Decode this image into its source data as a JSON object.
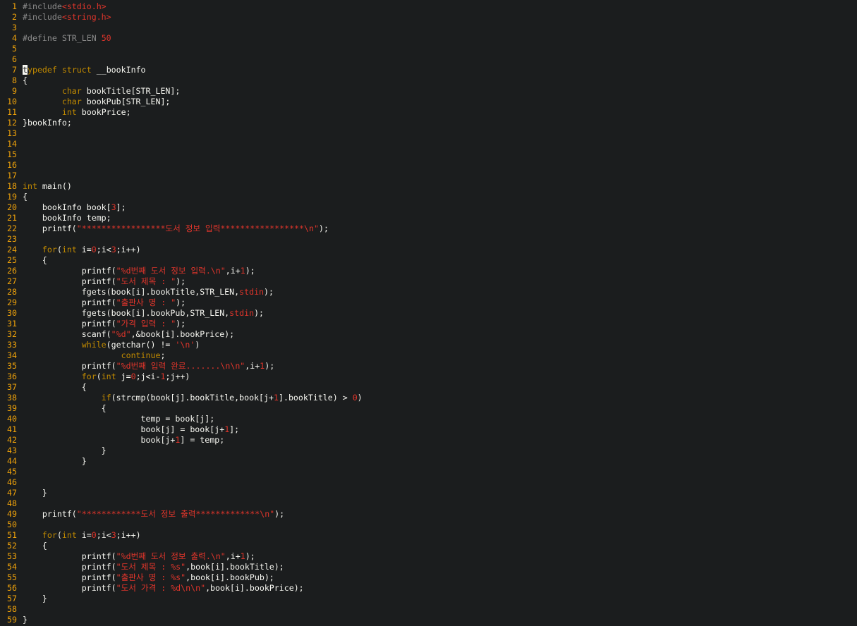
{
  "editor": {
    "lines": [
      {
        "n": "1",
        "tokens": [
          {
            "t": "#include",
            "c": "pp"
          },
          {
            "t": "<stdio.h>",
            "c": "str"
          }
        ]
      },
      {
        "n": "2",
        "tokens": [
          {
            "t": "#include",
            "c": "pp"
          },
          {
            "t": "<string.h>",
            "c": "str"
          }
        ]
      },
      {
        "n": "3",
        "tokens": []
      },
      {
        "n": "4",
        "tokens": [
          {
            "t": "#define STR_LEN ",
            "c": "pp"
          },
          {
            "t": "50",
            "c": "num"
          }
        ]
      },
      {
        "n": "5",
        "tokens": []
      },
      {
        "n": "6",
        "tokens": []
      },
      {
        "n": "7",
        "tokens": [
          {
            "t": "t",
            "c": "cursor"
          },
          {
            "t": "ypedef",
            "c": "kw"
          },
          {
            "t": " ",
            "c": "id"
          },
          {
            "t": "struct",
            "c": "kw"
          },
          {
            "t": " __bookInfo",
            "c": "id"
          }
        ]
      },
      {
        "n": "8",
        "tokens": [
          {
            "t": "{",
            "c": "id"
          }
        ]
      },
      {
        "n": "9",
        "tokens": [
          {
            "t": "        ",
            "c": "id"
          },
          {
            "t": "char",
            "c": "ty"
          },
          {
            "t": " bookTitle[STR_LEN];",
            "c": "id"
          }
        ]
      },
      {
        "n": "10",
        "tokens": [
          {
            "t": "        ",
            "c": "id"
          },
          {
            "t": "char",
            "c": "ty"
          },
          {
            "t": " bookPub[STR_LEN];",
            "c": "id"
          }
        ]
      },
      {
        "n": "11",
        "tokens": [
          {
            "t": "        ",
            "c": "id"
          },
          {
            "t": "int",
            "c": "ty"
          },
          {
            "t": " bookPrice;",
            "c": "id"
          }
        ]
      },
      {
        "n": "12",
        "tokens": [
          {
            "t": "}bookInfo;",
            "c": "id"
          }
        ]
      },
      {
        "n": "13",
        "tokens": []
      },
      {
        "n": "14",
        "tokens": []
      },
      {
        "n": "15",
        "tokens": []
      },
      {
        "n": "16",
        "tokens": []
      },
      {
        "n": "17",
        "tokens": []
      },
      {
        "n": "18",
        "tokens": [
          {
            "t": "int",
            "c": "ty"
          },
          {
            "t": " main()",
            "c": "id"
          }
        ]
      },
      {
        "n": "19",
        "tokens": [
          {
            "t": "{",
            "c": "id"
          }
        ]
      },
      {
        "n": "20",
        "tokens": [
          {
            "t": "    bookInfo book[",
            "c": "id"
          },
          {
            "t": "3",
            "c": "num"
          },
          {
            "t": "];",
            "c": "id"
          }
        ]
      },
      {
        "n": "21",
        "tokens": [
          {
            "t": "    bookInfo temp;",
            "c": "id"
          }
        ]
      },
      {
        "n": "22",
        "tokens": [
          {
            "t": "    printf(",
            "c": "id"
          },
          {
            "t": "\"*****************도서 정보 입력*****************\\n\"",
            "c": "str"
          },
          {
            "t": ");",
            "c": "id"
          }
        ]
      },
      {
        "n": "23",
        "tokens": []
      },
      {
        "n": "24",
        "tokens": [
          {
            "t": "    ",
            "c": "id"
          },
          {
            "t": "for",
            "c": "kw"
          },
          {
            "t": "(",
            "c": "id"
          },
          {
            "t": "int",
            "c": "ty"
          },
          {
            "t": " i=",
            "c": "id"
          },
          {
            "t": "0",
            "c": "num"
          },
          {
            "t": ";i<",
            "c": "id"
          },
          {
            "t": "3",
            "c": "num"
          },
          {
            "t": ";i++)",
            "c": "id"
          }
        ]
      },
      {
        "n": "25",
        "tokens": [
          {
            "t": "    {",
            "c": "id"
          }
        ]
      },
      {
        "n": "26",
        "tokens": [
          {
            "t": "            printf(",
            "c": "id"
          },
          {
            "t": "\"%d번째 도서 정보 입력.\\n\"",
            "c": "str"
          },
          {
            "t": ",i+",
            "c": "id"
          },
          {
            "t": "1",
            "c": "num"
          },
          {
            "t": ");",
            "c": "id"
          }
        ]
      },
      {
        "n": "27",
        "tokens": [
          {
            "t": "            printf(",
            "c": "id"
          },
          {
            "t": "\"도서 제목 : \"",
            "c": "str"
          },
          {
            "t": ");",
            "c": "id"
          }
        ]
      },
      {
        "n": "28",
        "tokens": [
          {
            "t": "            fgets(book[i].bookTitle,STR_LEN,",
            "c": "id"
          },
          {
            "t": "stdin",
            "c": "str"
          },
          {
            "t": ");",
            "c": "id"
          }
        ]
      },
      {
        "n": "29",
        "tokens": [
          {
            "t": "            printf(",
            "c": "id"
          },
          {
            "t": "\"출판사 명 : \"",
            "c": "str"
          },
          {
            "t": ");",
            "c": "id"
          }
        ]
      },
      {
        "n": "30",
        "tokens": [
          {
            "t": "            fgets(book[i].bookPub,STR_LEN,",
            "c": "id"
          },
          {
            "t": "stdin",
            "c": "str"
          },
          {
            "t": ");",
            "c": "id"
          }
        ]
      },
      {
        "n": "31",
        "tokens": [
          {
            "t": "            printf(",
            "c": "id"
          },
          {
            "t": "\"가격 입력 : \"",
            "c": "str"
          },
          {
            "t": ");",
            "c": "id"
          }
        ]
      },
      {
        "n": "32",
        "tokens": [
          {
            "t": "            scanf(",
            "c": "id"
          },
          {
            "t": "\"%d\"",
            "c": "str"
          },
          {
            "t": ",&book[i].bookPrice);",
            "c": "id"
          }
        ]
      },
      {
        "n": "33",
        "tokens": [
          {
            "t": "            ",
            "c": "id"
          },
          {
            "t": "while",
            "c": "kw"
          },
          {
            "t": "(getchar() != ",
            "c": "id"
          },
          {
            "t": "'\\n'",
            "c": "str"
          },
          {
            "t": ")",
            "c": "id"
          }
        ]
      },
      {
        "n": "34",
        "tokens": [
          {
            "t": "                    ",
            "c": "id"
          },
          {
            "t": "continue",
            "c": "kw"
          },
          {
            "t": ";",
            "c": "id"
          }
        ]
      },
      {
        "n": "35",
        "tokens": [
          {
            "t": "            printf(",
            "c": "id"
          },
          {
            "t": "\"%d번째 입력 완료.......\\n\\n\"",
            "c": "str"
          },
          {
            "t": ",i+",
            "c": "id"
          },
          {
            "t": "1",
            "c": "num"
          },
          {
            "t": ");",
            "c": "id"
          }
        ]
      },
      {
        "n": "36",
        "tokens": [
          {
            "t": "            ",
            "c": "id"
          },
          {
            "t": "for",
            "c": "kw"
          },
          {
            "t": "(",
            "c": "id"
          },
          {
            "t": "int",
            "c": "ty"
          },
          {
            "t": " j=",
            "c": "id"
          },
          {
            "t": "0",
            "c": "num"
          },
          {
            "t": ";j<i-",
            "c": "id"
          },
          {
            "t": "1",
            "c": "num"
          },
          {
            "t": ";j++)",
            "c": "id"
          }
        ]
      },
      {
        "n": "37",
        "tokens": [
          {
            "t": "            {",
            "c": "id"
          }
        ]
      },
      {
        "n": "38",
        "tokens": [
          {
            "t": "                ",
            "c": "id"
          },
          {
            "t": "if",
            "c": "kw"
          },
          {
            "t": "(strcmp(book[j].bookTitle,book[j+",
            "c": "id"
          },
          {
            "t": "1",
            "c": "num"
          },
          {
            "t": "].bookTitle) > ",
            "c": "id"
          },
          {
            "t": "0",
            "c": "num"
          },
          {
            "t": ")",
            "c": "id"
          }
        ]
      },
      {
        "n": "39",
        "tokens": [
          {
            "t": "                {",
            "c": "id"
          }
        ]
      },
      {
        "n": "40",
        "tokens": [
          {
            "t": "                        temp = book[j];",
            "c": "id"
          }
        ]
      },
      {
        "n": "41",
        "tokens": [
          {
            "t": "                        book[j] = book[j+",
            "c": "id"
          },
          {
            "t": "1",
            "c": "num"
          },
          {
            "t": "];",
            "c": "id"
          }
        ]
      },
      {
        "n": "42",
        "tokens": [
          {
            "t": "                        book[j+",
            "c": "id"
          },
          {
            "t": "1",
            "c": "num"
          },
          {
            "t": "] = temp;",
            "c": "id"
          }
        ]
      },
      {
        "n": "43",
        "tokens": [
          {
            "t": "                }",
            "c": "id"
          }
        ]
      },
      {
        "n": "44",
        "tokens": [
          {
            "t": "            }",
            "c": "id"
          }
        ]
      },
      {
        "n": "45",
        "tokens": []
      },
      {
        "n": "46",
        "tokens": []
      },
      {
        "n": "47",
        "tokens": [
          {
            "t": "    }",
            "c": "id"
          }
        ]
      },
      {
        "n": "48",
        "tokens": []
      },
      {
        "n": "49",
        "tokens": [
          {
            "t": "    printf(",
            "c": "id"
          },
          {
            "t": "\"************도서 정보 출력*************\\n\"",
            "c": "str"
          },
          {
            "t": ");",
            "c": "id"
          }
        ]
      },
      {
        "n": "50",
        "tokens": []
      },
      {
        "n": "51",
        "tokens": [
          {
            "t": "    ",
            "c": "id"
          },
          {
            "t": "for",
            "c": "kw"
          },
          {
            "t": "(",
            "c": "id"
          },
          {
            "t": "int",
            "c": "ty"
          },
          {
            "t": " i=",
            "c": "id"
          },
          {
            "t": "0",
            "c": "num"
          },
          {
            "t": ";i<",
            "c": "id"
          },
          {
            "t": "3",
            "c": "num"
          },
          {
            "t": ";i++)",
            "c": "id"
          }
        ]
      },
      {
        "n": "52",
        "tokens": [
          {
            "t": "    {",
            "c": "id"
          }
        ]
      },
      {
        "n": "53",
        "tokens": [
          {
            "t": "            printf(",
            "c": "id"
          },
          {
            "t": "\"%d번째 도서 정보 출력.\\n\"",
            "c": "str"
          },
          {
            "t": ",i+",
            "c": "id"
          },
          {
            "t": "1",
            "c": "num"
          },
          {
            "t": ");",
            "c": "id"
          }
        ]
      },
      {
        "n": "54",
        "tokens": [
          {
            "t": "            printf(",
            "c": "id"
          },
          {
            "t": "\"도서 제목 : %s\"",
            "c": "str"
          },
          {
            "t": ",book[i].bookTitle);",
            "c": "id"
          }
        ]
      },
      {
        "n": "55",
        "tokens": [
          {
            "t": "            printf(",
            "c": "id"
          },
          {
            "t": "\"출판사 명 : %s\"",
            "c": "str"
          },
          {
            "t": ",book[i].bookPub);",
            "c": "id"
          }
        ]
      },
      {
        "n": "56",
        "tokens": [
          {
            "t": "            printf(",
            "c": "id"
          },
          {
            "t": "\"도서 가격 : %d\\n\\n\"",
            "c": "str"
          },
          {
            "t": ",book[i].bookPrice);",
            "c": "id"
          }
        ]
      },
      {
        "n": "57",
        "tokens": [
          {
            "t": "    }",
            "c": "id"
          }
        ]
      },
      {
        "n": "58",
        "tokens": []
      },
      {
        "n": "59",
        "tokens": [
          {
            "t": "}",
            "c": "id"
          }
        ]
      }
    ]
  }
}
